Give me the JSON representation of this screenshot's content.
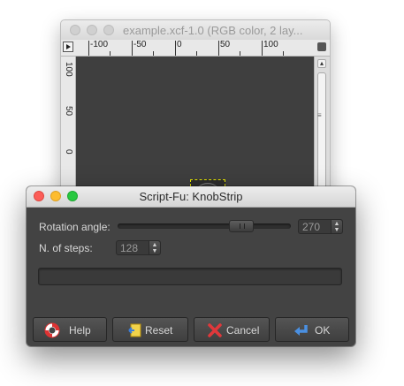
{
  "image_window": {
    "title": "example.xcf-1.0 (RGB color, 2 lay...",
    "ruler_h_labels": [
      "-100",
      "-50",
      "0",
      "50",
      "100"
    ],
    "ruler_v_labels": [
      "100",
      "50",
      "0"
    ]
  },
  "dialog": {
    "title": "Script-Fu: KnobStrip",
    "rotation_label": "Rotation angle:",
    "rotation_value": "270",
    "rotation_fraction": 0.75,
    "steps_label": "N. of steps:",
    "steps_value": "128",
    "progress_fraction": 0,
    "buttons": {
      "help": "Help",
      "reset": "Reset",
      "cancel": "Cancel",
      "ok": "OK"
    }
  },
  "icons": {
    "help": "lifebuoy-icon",
    "reset": "reset-icon",
    "cancel": "cancel-x-icon",
    "ok": "enter-arrow-icon"
  },
  "colors": {
    "dialog_bg": "#434343",
    "canvas_bg": "#3f3f3f",
    "close": "#fc5d57",
    "minimize": "#fdbc2e",
    "zoom": "#28c840",
    "cancel_x": "#e0383b",
    "ok_arrow": "#4a90e2"
  }
}
